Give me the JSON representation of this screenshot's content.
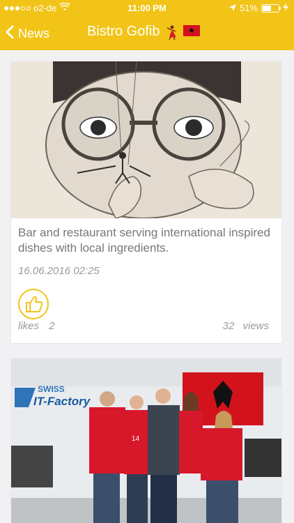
{
  "status_bar": {
    "carrier": "o2-de",
    "time": "11:00 PM",
    "battery": "51%",
    "battery_level": 0.51,
    "signal_bars": 3
  },
  "nav": {
    "back_label": "News",
    "title": "Bistro Gofib",
    "title_emojis": [
      "dancer-icon",
      "albania-flag-icon"
    ]
  },
  "posts": [
    {
      "description_line1": "Bar and restaurant serving international inspired",
      "description_line2": "dishes with local ingredients.",
      "date": "16.06.2016 02:25",
      "likes_label": "likes",
      "likes_count": "2",
      "views_count": "32",
      "views_label": "views",
      "image": "illustration of a face with glasses and tiny figure"
    },
    {
      "image": "team photo in red football jerseys in front of Albanian flag",
      "logo_line1": "SWISS",
      "logo_line2": "IT-Factory",
      "jersey_number": "14"
    }
  ],
  "colors": {
    "accent": "#f2c418",
    "background": "#f1f1f4",
    "text_muted": "#777777"
  }
}
